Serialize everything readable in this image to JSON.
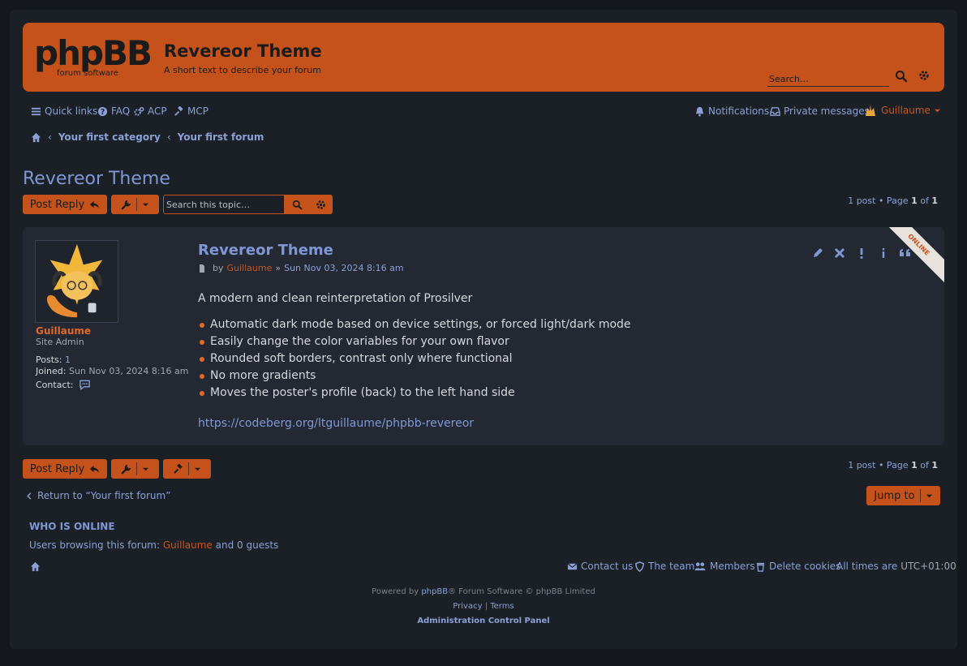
{
  "header": {
    "logo_text": "phpBB",
    "logo_sub": "forum software",
    "site_title": "Revereor Theme",
    "site_description": "A short text to describe your forum",
    "search_placeholder": "Search…"
  },
  "navbar": {
    "quick_links": "Quick links",
    "faq": "FAQ",
    "acp": "ACP",
    "mcp": "MCP",
    "notifications": "Notifications",
    "private_messages": "Private messages",
    "username": "Guillaume"
  },
  "breadcrumbs": {
    "sep": "‹",
    "items": [
      "Your first category",
      "Your first forum"
    ]
  },
  "topic": {
    "title": "Revereor Theme",
    "post_reply": "Post Reply",
    "search_placeholder": "Search this topic…",
    "pagination_prefix": "1 post • Page",
    "page_current": "1",
    "page_of": "of",
    "page_total": "1"
  },
  "post": {
    "title": "Revereor Theme",
    "by": "by",
    "author": "Guillaume",
    "date_sep": "»",
    "date": "Sun Nov 03, 2024 8:16 am",
    "intro": "A modern and clean reinterpretation of Prosilver",
    "features": [
      "Automatic dark mode based on device settings, or forced light/dark mode",
      "Easily change the color variables for your own flavor",
      "Rounded soft borders, contrast only where functional",
      "No more gradients",
      "Moves the poster's profile (back) to the left hand side"
    ],
    "link": "https://codeberg.org/ltguillaume/phpbb-revereor",
    "online_badge": "ONLINE"
  },
  "profile": {
    "name": "Guillaume",
    "rank": "Site Admin",
    "posts_label": "Posts:",
    "posts_value": "1",
    "joined_label": "Joined:",
    "joined_value": "Sun Nov 03, 2024 8:16 am",
    "contact_label": "Contact:"
  },
  "bottom": {
    "return_text": "Return to “Your first forum”",
    "jump_to": "Jump to"
  },
  "who_is_online": {
    "title": "WHO IS ONLINE",
    "text_prefix": "Users browsing this forum:",
    "user": "Guillaume",
    "text_suffix": "and 0 guests"
  },
  "footer": {
    "contact_us": "Contact us",
    "the_team": "The team",
    "members": "Members",
    "delete_cookies": "Delete cookies",
    "timezone_prefix": "All times are",
    "timezone": "UTC+01:00",
    "powered_by": "Powered by",
    "phpbb": "phpBB",
    "powered_suffix": "® Forum Software © phpBB Limited",
    "privacy": "Privacy",
    "link_sep": "|",
    "terms": "Terms",
    "acp_link": "Administration Control Panel"
  },
  "colors": {
    "accent": "#c5521a",
    "background": "#1b1f26",
    "link": "#7f97d4"
  }
}
